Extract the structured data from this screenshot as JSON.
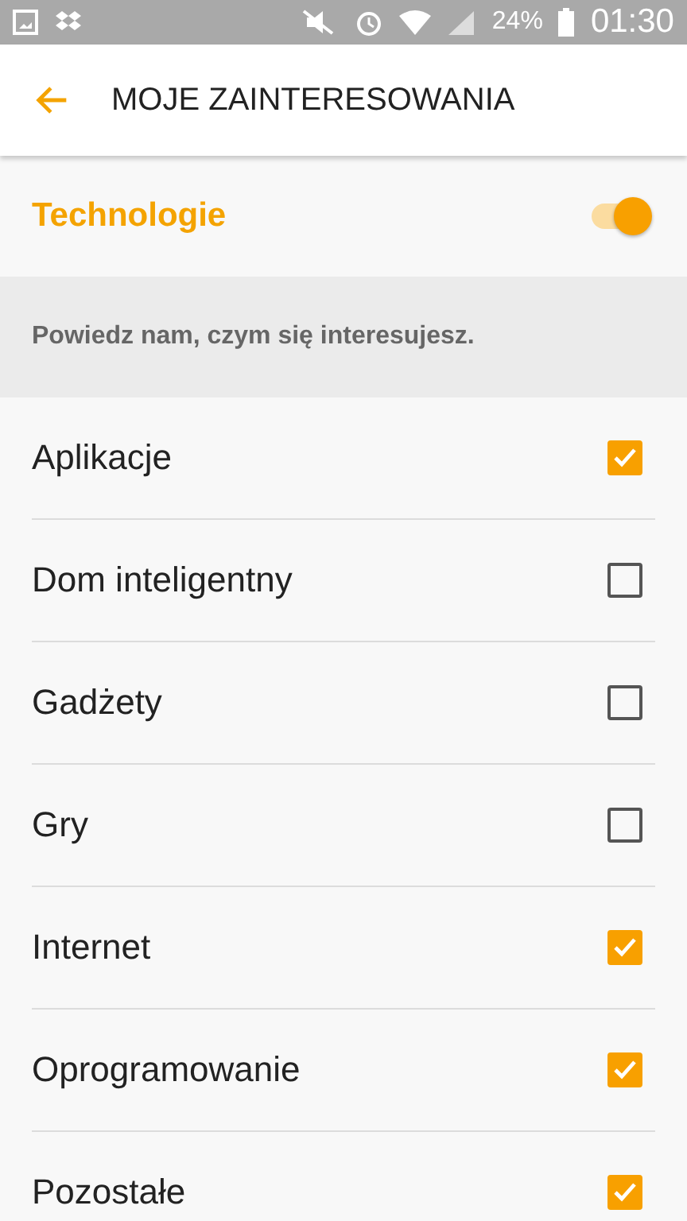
{
  "status_bar": {
    "battery": "24%",
    "time": "01:30"
  },
  "app_bar": {
    "title": "MOJE ZAINTERESOWANIA"
  },
  "master": {
    "label": "Technologie",
    "on": true
  },
  "description": "Powiedz nam, czym się interesujesz.",
  "items": [
    {
      "label": "Aplikacje",
      "checked": true
    },
    {
      "label": "Dom inteligentny",
      "checked": false
    },
    {
      "label": "Gadżety",
      "checked": false
    },
    {
      "label": "Gry",
      "checked": false
    },
    {
      "label": "Internet",
      "checked": true
    },
    {
      "label": "Oprogramowanie",
      "checked": true
    },
    {
      "label": "Pozostałe",
      "checked": true
    }
  ]
}
